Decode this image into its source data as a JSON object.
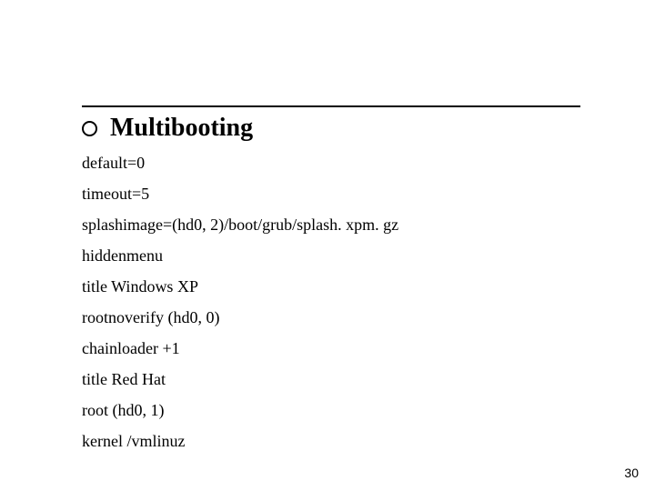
{
  "title": "Multibooting",
  "lines": {
    "default": "default=0",
    "timeout": "timeout=5",
    "splashimage": "splashimage=(hd0, 2)/boot/grub/splash. xpm. gz",
    "hiddenmenu": "hiddenmenu",
    "title_win": "title Windows XP",
    "rootnoverify": "rootnoverify (hd0, 0)",
    "chainloader": "chainloader +1",
    "title_rh": "title Red Hat",
    "root": "root (hd0, 1)",
    "kernel": "kernel /vmlinuz"
  },
  "page_number": "30"
}
